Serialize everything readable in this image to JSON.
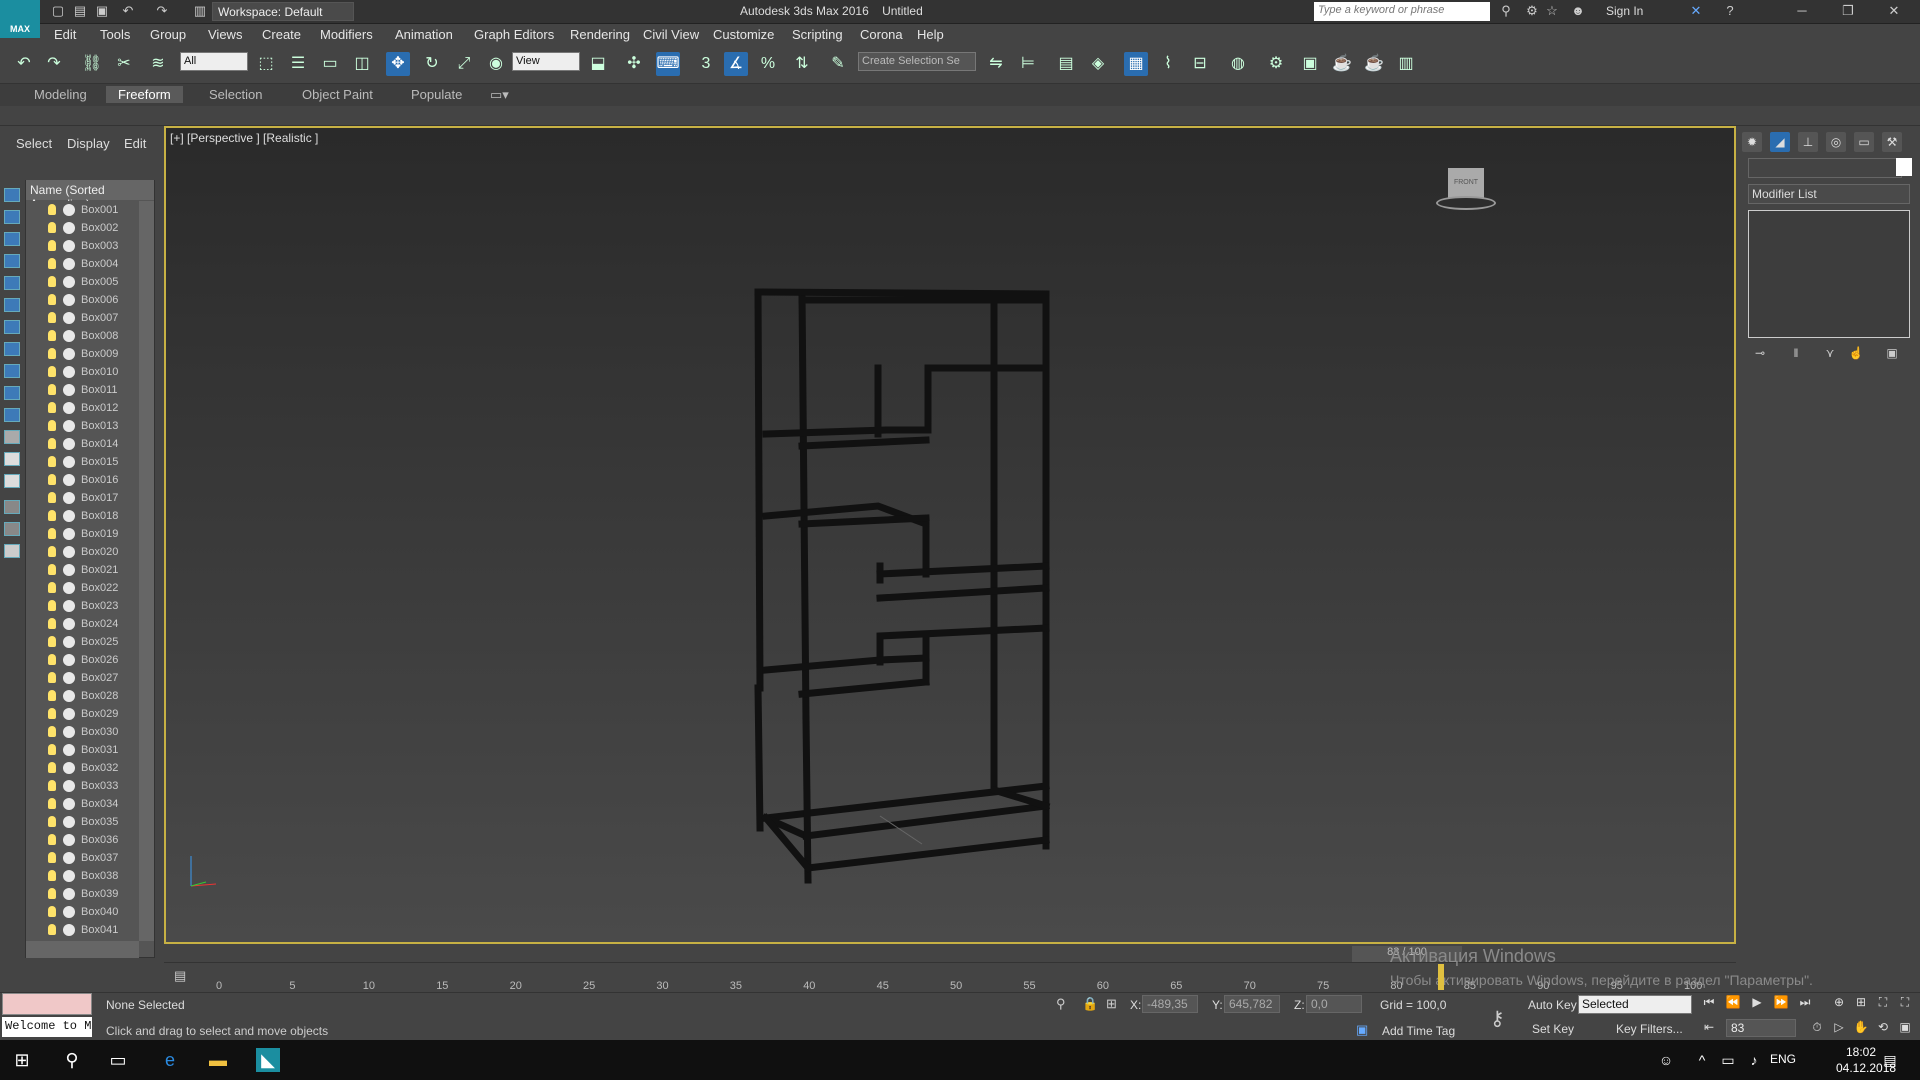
{
  "app": {
    "title": "Autodesk 3ds Max 2016",
    "doc": "Untitled",
    "logo": "MAX"
  },
  "workspace": "Workspace: Default",
  "search_placeholder": "Type a keyword or phrase",
  "signin": "Sign In",
  "menu": [
    "Edit",
    "Tools",
    "Group",
    "Views",
    "Create",
    "Modifiers",
    "Animation",
    "Graph Editors",
    "Rendering",
    "Civil View",
    "Customize",
    "Scripting",
    "Corona",
    "Help"
  ],
  "toolbar": {
    "filter": "All",
    "ref_coord": "View",
    "selection_set": "Create Selection Se",
    "snap_label": "3"
  },
  "ribbon_tabs": [
    "Modeling",
    "Freeform",
    "Selection",
    "Object Paint",
    "Populate"
  ],
  "ribbon_active": "Freeform",
  "scene_tabs": [
    "Select",
    "Display",
    "Edit"
  ],
  "explorer": {
    "header": "Name (Sorted Ascending)",
    "items": [
      "Box001",
      "Box002",
      "Box003",
      "Box004",
      "Box005",
      "Box006",
      "Box007",
      "Box008",
      "Box009",
      "Box010",
      "Box011",
      "Box012",
      "Box013",
      "Box014",
      "Box015",
      "Box016",
      "Box017",
      "Box018",
      "Box019",
      "Box020",
      "Box021",
      "Box022",
      "Box023",
      "Box024",
      "Box025",
      "Box026",
      "Box027",
      "Box028",
      "Box029",
      "Box030",
      "Box031",
      "Box032",
      "Box033",
      "Box034",
      "Box035",
      "Box036",
      "Box037",
      "Box038",
      "Box039",
      "Box040",
      "Box041"
    ]
  },
  "viewport": {
    "label": "[+] [Perspective ] [Realistic ]",
    "viewcube": "FRONT"
  },
  "command_panel": {
    "modifier_list": "Modifier List"
  },
  "timeline": {
    "slider": "83 / 100",
    "ticks": [
      "0",
      "5",
      "10",
      "15",
      "20",
      "25",
      "30",
      "35",
      "40",
      "45",
      "50",
      "55",
      "60",
      "65",
      "70",
      "75",
      "80",
      "85",
      "90",
      "95",
      "100"
    ],
    "current_frame": 83
  },
  "watermark": {
    "line1": "Активация Windows",
    "line2": "Чтобы активировать Windows, перейдите в раздел \"Параметры\"."
  },
  "status": {
    "maxscript": "",
    "welcome": "Welcome to M",
    "selection": "None Selected",
    "prompt": "Click and drag to select and move objects",
    "x_label": "X:",
    "x": "-489,35",
    "y_label": "Y:",
    "y": "645,782",
    "z_label": "Z:",
    "z": "0,0",
    "grid": "Grid = 100,0",
    "add_time_tag": "Add Time Tag",
    "auto_key": "Auto Key",
    "set_key": "Set Key",
    "selected": "Selected",
    "key_filters": "Key Filters...",
    "frame": "83"
  },
  "taskbar": {
    "lang": "ENG",
    "time": "18:02",
    "date": "04.12.2018"
  },
  "colors": {
    "viewport_border": "#c7b144",
    "active_tool": "#2a6db0",
    "logo": "#1b8ea0"
  }
}
